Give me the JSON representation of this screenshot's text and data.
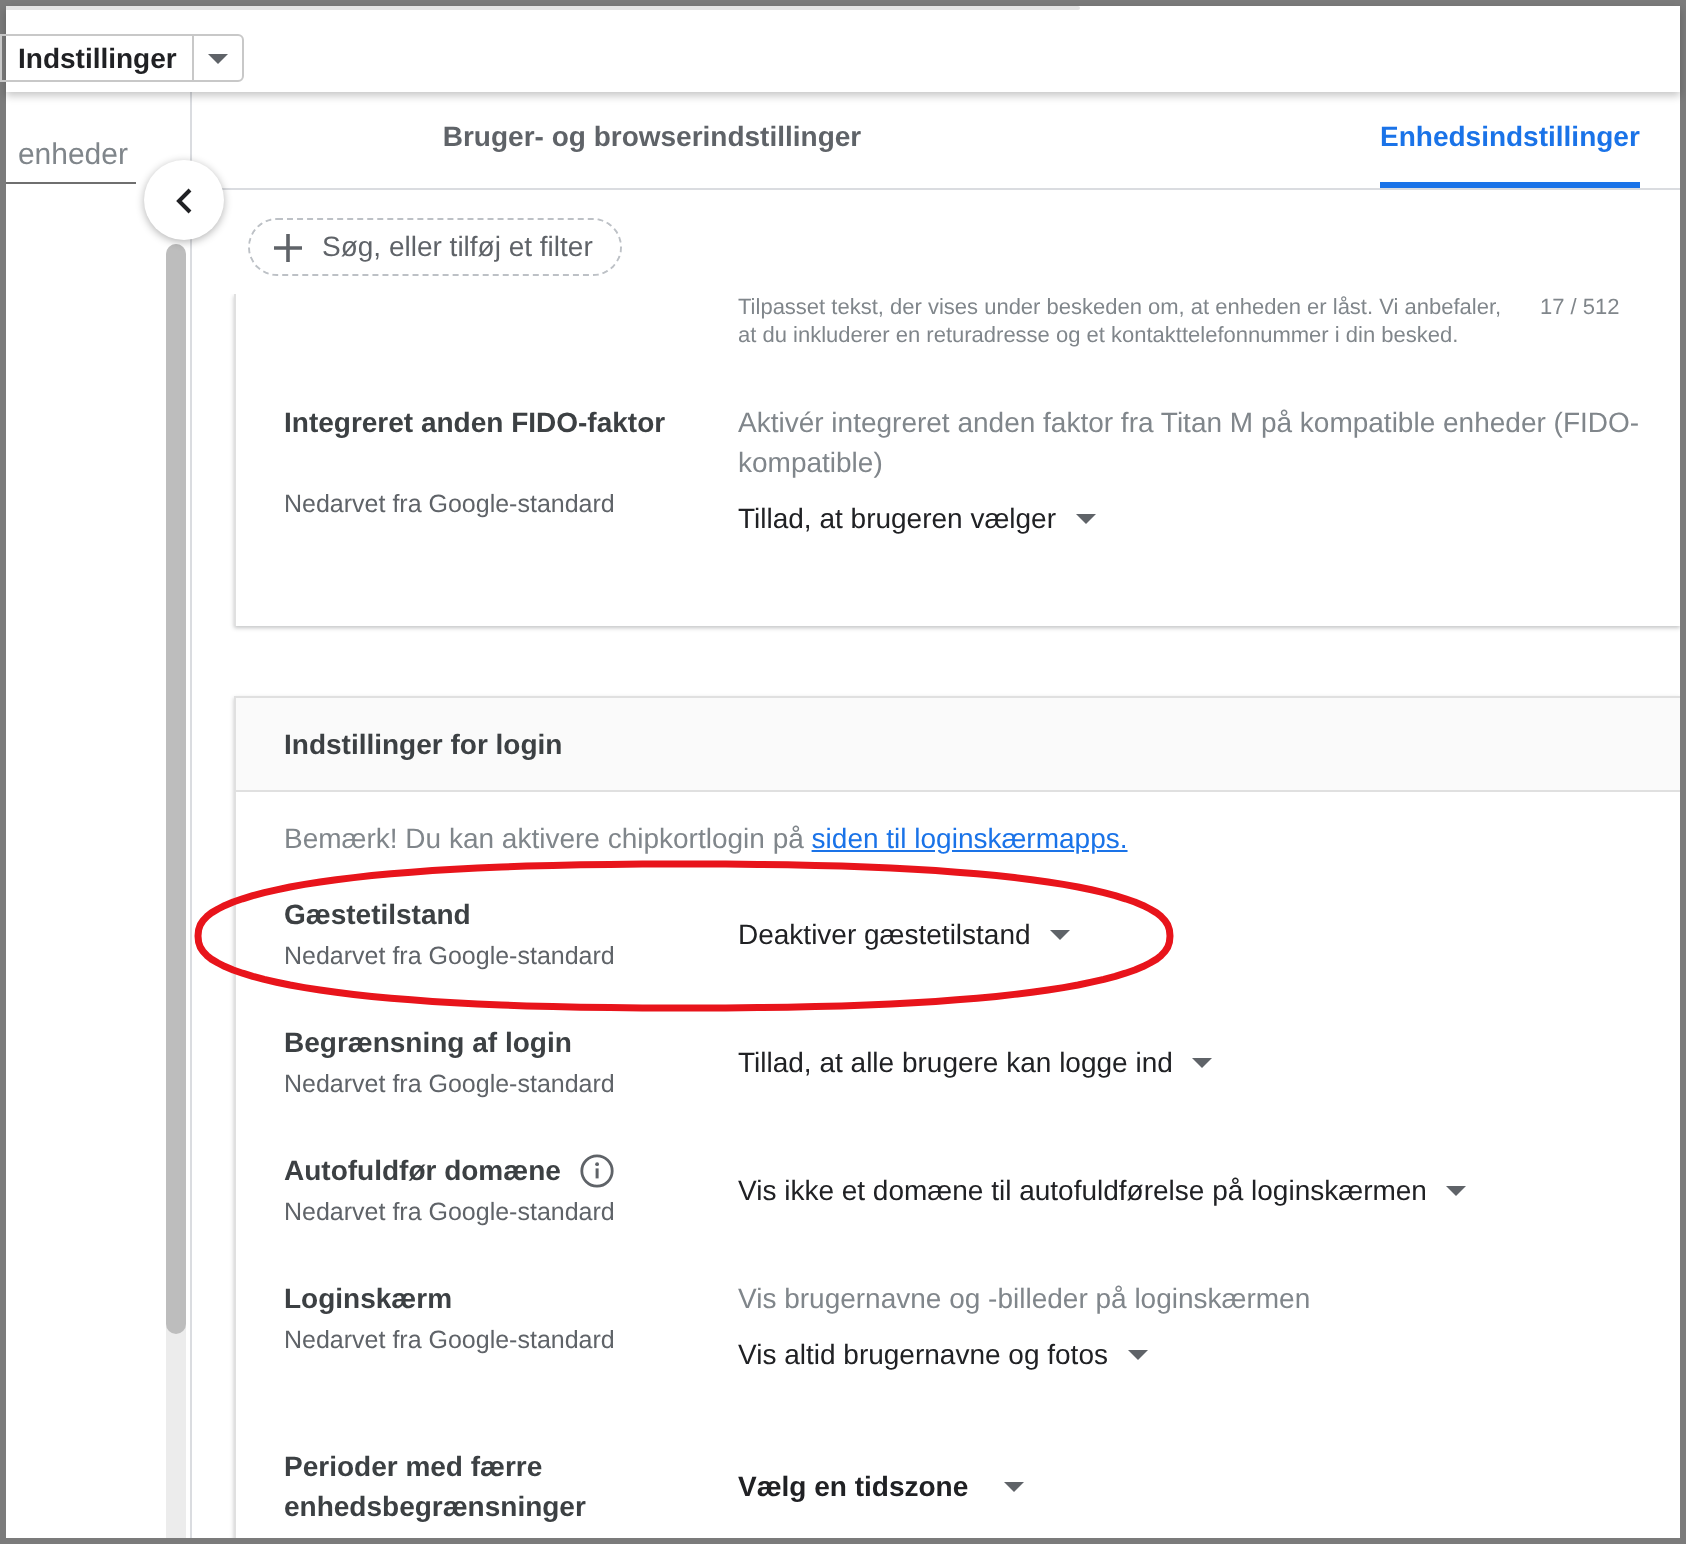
{
  "top_bar": {
    "menu_button": "Indstillinger"
  },
  "sidebar": {
    "search": {
      "placeholder": "enheder"
    }
  },
  "tabs": [
    {
      "label": "Bruger- og browserindstillinger",
      "selected": false
    },
    {
      "label": "Enhedsindstillinger",
      "selected": true
    }
  ],
  "filter": {
    "label": "Søg, eller tilføj et filter"
  },
  "sections": [
    {
      "message": {
        "text": "Tilpasset tekst, der vises under beskeden om, at enheden er låst. Vi anbefaler, at du inkluderer en returadresse og et kontakttelefonnummer i din besked.",
        "counter": "17 / 512"
      },
      "settings": [
        {
          "label": "Integreret anden FIDO-faktor",
          "info_icon": false,
          "source": "Nedarvet fra Google-standard",
          "description": "Aktivér integreret anden faktor fra Titan M på kompatible enheder (FIDO-kompatible)",
          "dropdown": {
            "text": "Tillad, at brugeren vælger",
            "kind": "value"
          },
          "highlighted": false
        }
      ]
    },
    {
      "title": "Indstillinger for login",
      "note": {
        "text": "Bemærk! Du kan aktivere chipkortlogin på",
        "link": "siden til loginskærmapps."
      },
      "settings": [
        {
          "label": "Gæstetilstand",
          "info_icon": false,
          "source": "Nedarvet fra Google-standard",
          "dropdown": {
            "text": "Deaktiver gæstetilstand",
            "kind": "value"
          },
          "highlighted": true
        },
        {
          "label": "Begrænsning af login",
          "info_icon": false,
          "source": "Nedarvet fra Google-standard",
          "dropdown": {
            "text": "Tillad, at alle brugere kan logge ind",
            "kind": "value"
          },
          "highlighted": false
        },
        {
          "label": "Autofuldfør domæne",
          "info_icon": true,
          "source": "Nedarvet fra Google-standard",
          "dropdown": {
            "text": "Vis ikke et domæne til autofuldførelse på loginskærmen",
            "kind": "value"
          },
          "highlighted": false
        },
        {
          "label": "Loginskærm",
          "info_icon": false,
          "source": "Nedarvet fra Google-standard",
          "description": "Vis brugernavne og -billeder på loginskærmen",
          "dropdown": {
            "text": "Vis altid brugernavne og fotos",
            "kind": "value"
          },
          "highlighted": false
        },
        {
          "label": "Perioder med færre enhedsbegrænsninger",
          "info_icon": false,
          "dropdown": {
            "text": "Vælg en tidszone",
            "kind": "prompt"
          },
          "highlighted": false
        }
      ]
    }
  ]
}
